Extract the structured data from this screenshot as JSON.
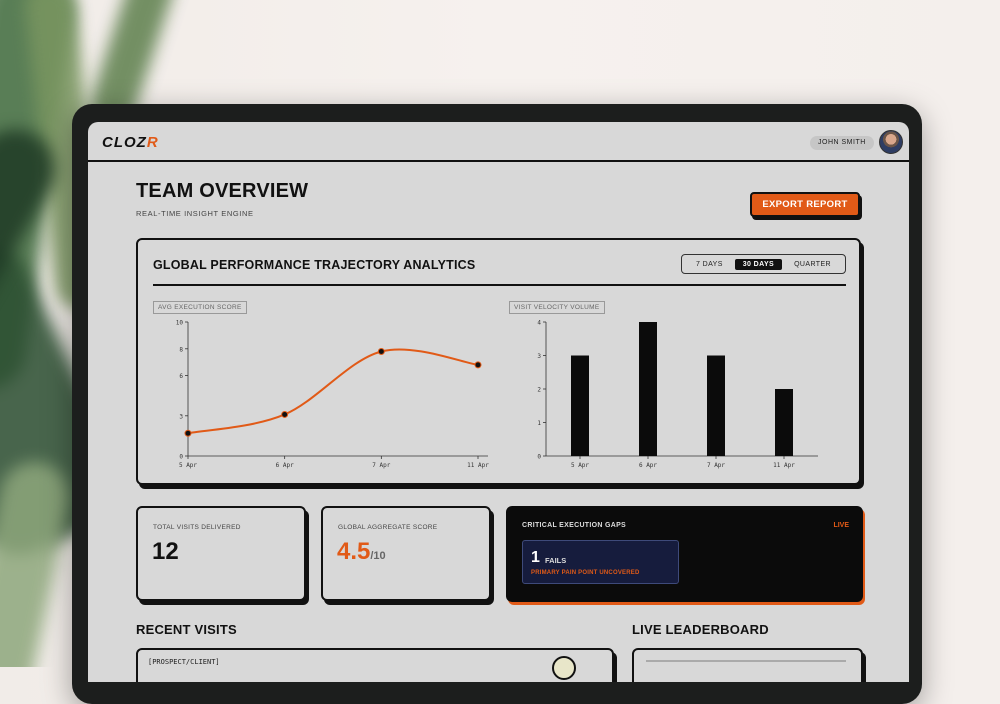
{
  "app": {
    "logo_prefix": "CLOZ",
    "logo_accent": "R",
    "user_name": "JOHN SMITH"
  },
  "header": {
    "title": "TEAM OVERVIEW",
    "subtitle": "REAL-TIME INSIGHT ENGINE",
    "export_label": "EXPORT REPORT"
  },
  "analytics": {
    "title": "GLOBAL PERFORMANCE TRAJECTORY ANALYTICS",
    "ranges": [
      "7 DAYS",
      "30 DAYS",
      "QUARTER"
    ],
    "active_range": "30 DAYS"
  },
  "chart_data": [
    {
      "type": "line",
      "title": "AVG EXECUTION SCORE",
      "x": [
        "5 Apr",
        "6 Apr",
        "7 Apr",
        "11 Apr"
      ],
      "values": [
        1.7,
        3.1,
        7.8,
        6.8
      ],
      "yticks": [
        0,
        3,
        6,
        8,
        10
      ],
      "ylim": [
        0,
        10
      ],
      "color": "#e15a17"
    },
    {
      "type": "bar",
      "title": "VISIT VELOCITY VOLUME",
      "categories": [
        "5 Apr",
        "6 Apr",
        "7 Apr",
        "11 Apr"
      ],
      "values": [
        3,
        4,
        3,
        2
      ],
      "yticks": [
        0,
        1,
        2,
        3,
        4
      ],
      "ylim": [
        0,
        4
      ],
      "color": "#0b0b0b"
    }
  ],
  "stats": {
    "visits_label": "TOTAL VISITS DELIVERED",
    "visits_value": "12",
    "score_label": "GLOBAL AGGREGATE SCORE",
    "score_value": "4.5",
    "score_suffix": "/10"
  },
  "gaps": {
    "title": "CRITICAL EXECUTION GAPS",
    "live": "LIVE",
    "fail_count": "1",
    "fail_label": "FAILS",
    "fail_detail": "PRIMARY PAIN POINT UNCOVERED"
  },
  "sections": {
    "recent": "RECENT VISITS",
    "leaderboard": "LIVE LEADERBOARD",
    "recent_row": "[PROSPECT/CLIENT]"
  },
  "colors": {
    "accent": "#e15a17",
    "ink": "#111111",
    "screen": "#d8d8d8",
    "alert_bg": "#161c3d"
  }
}
